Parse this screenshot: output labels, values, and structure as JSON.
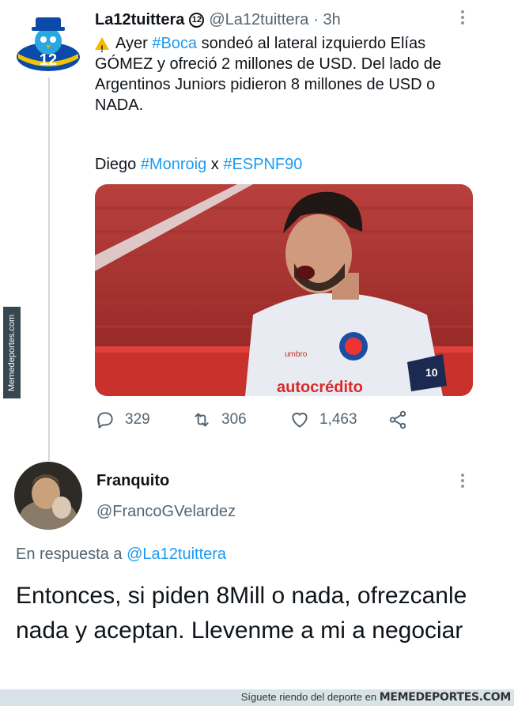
{
  "tweet": {
    "author_name": "La12tuittera",
    "badge": "12",
    "handle": "@La12tuittera",
    "time": "· 3h",
    "text_pre": "Ayer ",
    "text_hash1": "#Boca",
    "text_post": " sondeó al lateral izquierdo Elías GÓMEZ y ofreció 2 millones de USD. Del lado de Argentinos Juniors pidieron 8 millones de USD o NADA.",
    "credit_name": "Diego ",
    "credit_hash1": "#Monroig",
    "credit_sep": " x ",
    "credit_hash2": "#ESPNF90",
    "image_sponsor": "autocrédito",
    "image_kit": "umbro",
    "image_number": "10",
    "avatar_number": "12",
    "replies": "329",
    "retweets": "306",
    "likes": "1,463",
    "icons": [
      "warning-icon",
      "reply-icon",
      "retweet-icon",
      "like-icon",
      "share-icon",
      "more-icon"
    ]
  },
  "reply": {
    "author_name": "Franquito",
    "handle": "@FrancoGVelardez",
    "in_reply_label": "En respuesta a ",
    "in_reply_handle": "@La12tuittera",
    "text": "Entonces, si piden 8Mill o nada, ofrezcanle nada y aceptan. Llevenme a mi a negociar"
  },
  "watermark": {
    "side": "Memedeportes.com",
    "footer_text": "Síguete riendo del deporte en ",
    "footer_brand": "MEMEDEPORTES.COM"
  },
  "colors": {
    "link": "#1d9bf0",
    "muted": "#536471",
    "thread_line": "#cfd9de"
  }
}
